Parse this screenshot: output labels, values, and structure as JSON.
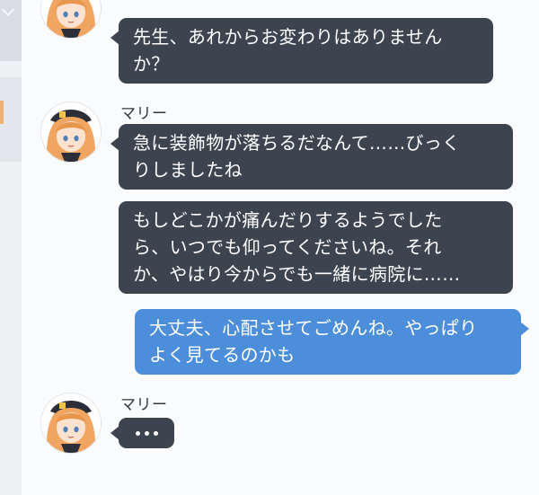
{
  "colors": {
    "student_bubble": "#3c4450",
    "sensei_bubble": "#4d8edb",
    "avatar_hair": "#f0a560",
    "sidebar_accent": "#f1b074"
  },
  "messages": [
    {
      "from": "student",
      "text": "先生、あれからお変わりはありません\nか？"
    },
    {
      "from": "student",
      "sender": "マリー",
      "text": "急に装飾物が落ちるだなんて……びっく\nりしましたね"
    },
    {
      "from": "student",
      "text": "もしどこかが痛んだりするようでした\nら、いつでも仰ってくださいね。それ\nか、やはり今からでも一緒に病院に……"
    },
    {
      "from": "sensei",
      "text": "大丈夫、心配させてごめんね。やっぱり\nよく見てるのかも"
    }
  ],
  "typing": {
    "sender": "マリー",
    "indicator": "typing-dots"
  }
}
